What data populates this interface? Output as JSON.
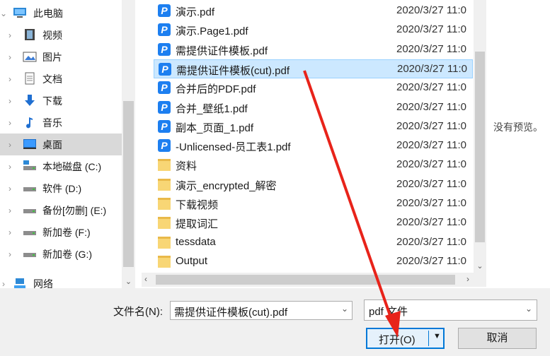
{
  "nav": {
    "items": [
      {
        "label": "此电脑",
        "icon": "computer-icon"
      },
      {
        "label": "视频",
        "icon": "video-icon"
      },
      {
        "label": "图片",
        "icon": "picture-icon"
      },
      {
        "label": "文档",
        "icon": "document-icon"
      },
      {
        "label": "下载",
        "icon": "download-icon"
      },
      {
        "label": "音乐",
        "icon": "music-icon"
      },
      {
        "label": "桌面",
        "icon": "desktop-icon"
      },
      {
        "label": "本地磁盘 (C:)",
        "icon": "drive-icon"
      },
      {
        "label": "软件 (D:)",
        "icon": "drive-icon"
      },
      {
        "label": "备份[勿删] (E:)",
        "icon": "drive-icon"
      },
      {
        "label": "新加卷 (F:)",
        "icon": "drive-icon"
      },
      {
        "label": "新加卷 (G:)",
        "icon": "drive-icon"
      },
      {
        "label": "网络",
        "icon": "network-icon"
      }
    ]
  },
  "files": [
    {
      "name": "演示.pdf",
      "date": "2020/3/27 11:0",
      "type": "pdf"
    },
    {
      "name": "演示.Page1.pdf",
      "date": "2020/3/27 11:0",
      "type": "pdf"
    },
    {
      "name": "需提供证件模板.pdf",
      "date": "2020/3/27 11:0",
      "type": "pdf"
    },
    {
      "name": "需提供证件模板(cut).pdf",
      "date": "2020/3/27 11:0",
      "type": "pdf"
    },
    {
      "name": "合并后的PDF.pdf",
      "date": "2020/3/27 11:0",
      "type": "pdf"
    },
    {
      "name": "合并_壁纸1.pdf",
      "date": "2020/3/27 11:0",
      "type": "pdf"
    },
    {
      "name": "副本_页面_1.pdf",
      "date": "2020/3/27 11:0",
      "type": "pdf"
    },
    {
      "name": "-Unlicensed-员工表1.pdf",
      "date": "2020/3/27 11:0",
      "type": "pdf"
    },
    {
      "name": "资料",
      "date": "2020/3/27 11:0",
      "type": "folder"
    },
    {
      "name": "演示_encrypted_解密",
      "date": "2020/3/27 11:0",
      "type": "folder"
    },
    {
      "name": "下载视频",
      "date": "2020/3/27 11:0",
      "type": "folder"
    },
    {
      "name": "提取词汇",
      "date": "2020/3/27 11:0",
      "type": "folder"
    },
    {
      "name": "tessdata",
      "date": "2020/3/27 11:0",
      "type": "folder"
    },
    {
      "name": "Output",
      "date": "2020/3/27 11:0",
      "type": "folder"
    }
  ],
  "preview": {
    "text": "没有预览。"
  },
  "bottom": {
    "filename_label": "文件名(N):",
    "filename_value": "需提供证件模板(cut).pdf",
    "filetype_value": "pdf 文件",
    "open_label": "打开(O)",
    "cancel_label": "取消"
  },
  "icons": {
    "pdf_glyph": "P"
  },
  "colors": {
    "accent": "#0078d7",
    "selection": "#cce8ff",
    "arrow": "#e8231a",
    "pdf": "#1d7ff0",
    "folder": "#f8d675"
  }
}
